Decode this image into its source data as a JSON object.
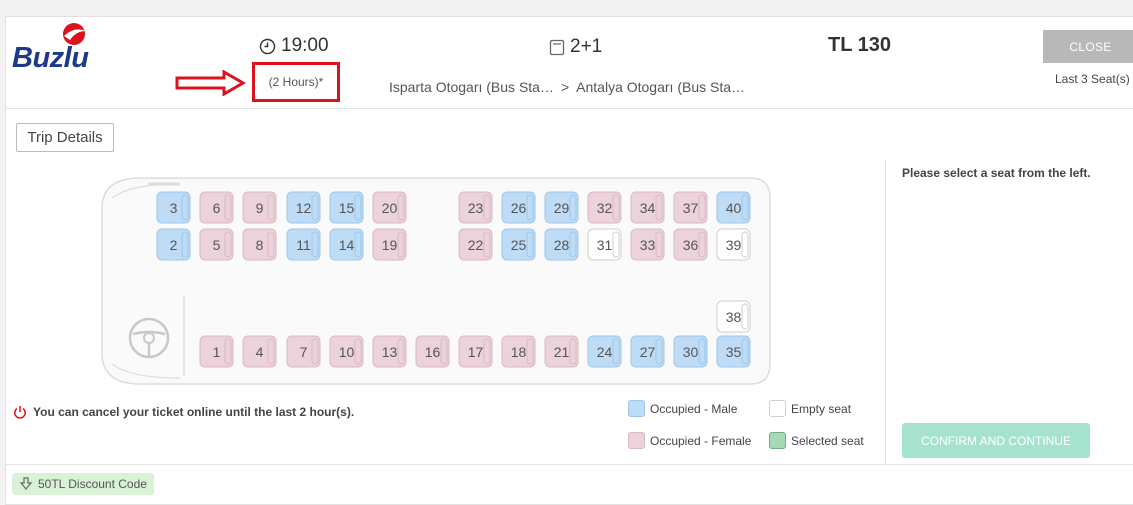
{
  "header": {
    "logo_text": "Buzlu",
    "time": "19:00",
    "duration": "(2 Hours)*",
    "layout": "2+1",
    "route_from": "Isparta Otogarı (Bus Sta…",
    "route_sep": ">",
    "route_to": "Antalya Otogarı (Bus Sta…",
    "price": "TL 130",
    "close_label": "CLOSE",
    "last_seats": "Last 3 Seat(s)"
  },
  "trip_details_label": "Trip Details",
  "cancel_info": "You can cancel your ticket online until the last 2 hour(s).",
  "legend": {
    "male": "Occupied - Male",
    "female": "Occupied - Female",
    "empty": "Empty seat",
    "selected": "Selected seat"
  },
  "select_message": "Please select a seat from the left.",
  "confirm_label": "CONFIRM AND CONTINUE",
  "discount_label": "50TL Discount Code",
  "colors": {
    "male": "#bfdcf7",
    "female": "#ecd3da",
    "empty": "#ffffff",
    "selected": "#a6d9b8",
    "confirm": "#a6e3cf",
    "highlight": "#d9141c"
  },
  "seats": [
    {
      "number": "3",
      "status": "male"
    },
    {
      "number": "6",
      "status": "female"
    },
    {
      "number": "9",
      "status": "female"
    },
    {
      "number": "12",
      "status": "male"
    },
    {
      "number": "15",
      "status": "male"
    },
    {
      "number": "20",
      "status": "female"
    },
    {
      "number": "23",
      "status": "female"
    },
    {
      "number": "26",
      "status": "male"
    },
    {
      "number": "29",
      "status": "male"
    },
    {
      "number": "32",
      "status": "female"
    },
    {
      "number": "34",
      "status": "female"
    },
    {
      "number": "37",
      "status": "female"
    },
    {
      "number": "40",
      "status": "male"
    },
    {
      "number": "2",
      "status": "male"
    },
    {
      "number": "5",
      "status": "female"
    },
    {
      "number": "8",
      "status": "female"
    },
    {
      "number": "11",
      "status": "male"
    },
    {
      "number": "14",
      "status": "male"
    },
    {
      "number": "19",
      "status": "female"
    },
    {
      "number": "22",
      "status": "female"
    },
    {
      "number": "25",
      "status": "male"
    },
    {
      "number": "28",
      "status": "male"
    },
    {
      "number": "31",
      "status": "empty"
    },
    {
      "number": "33",
      "status": "female"
    },
    {
      "number": "36",
      "status": "female"
    },
    {
      "number": "39",
      "status": "empty"
    },
    {
      "number": "38",
      "status": "empty"
    },
    {
      "number": "1",
      "status": "female"
    },
    {
      "number": "4",
      "status": "female"
    },
    {
      "number": "7",
      "status": "female"
    },
    {
      "number": "10",
      "status": "female"
    },
    {
      "number": "13",
      "status": "female"
    },
    {
      "number": "16",
      "status": "female"
    },
    {
      "number": "17",
      "status": "female"
    },
    {
      "number": "18",
      "status": "female"
    },
    {
      "number": "21",
      "status": "female"
    },
    {
      "number": "24",
      "status": "male"
    },
    {
      "number": "27",
      "status": "male"
    },
    {
      "number": "30",
      "status": "male"
    },
    {
      "number": "35",
      "status": "male"
    }
  ]
}
